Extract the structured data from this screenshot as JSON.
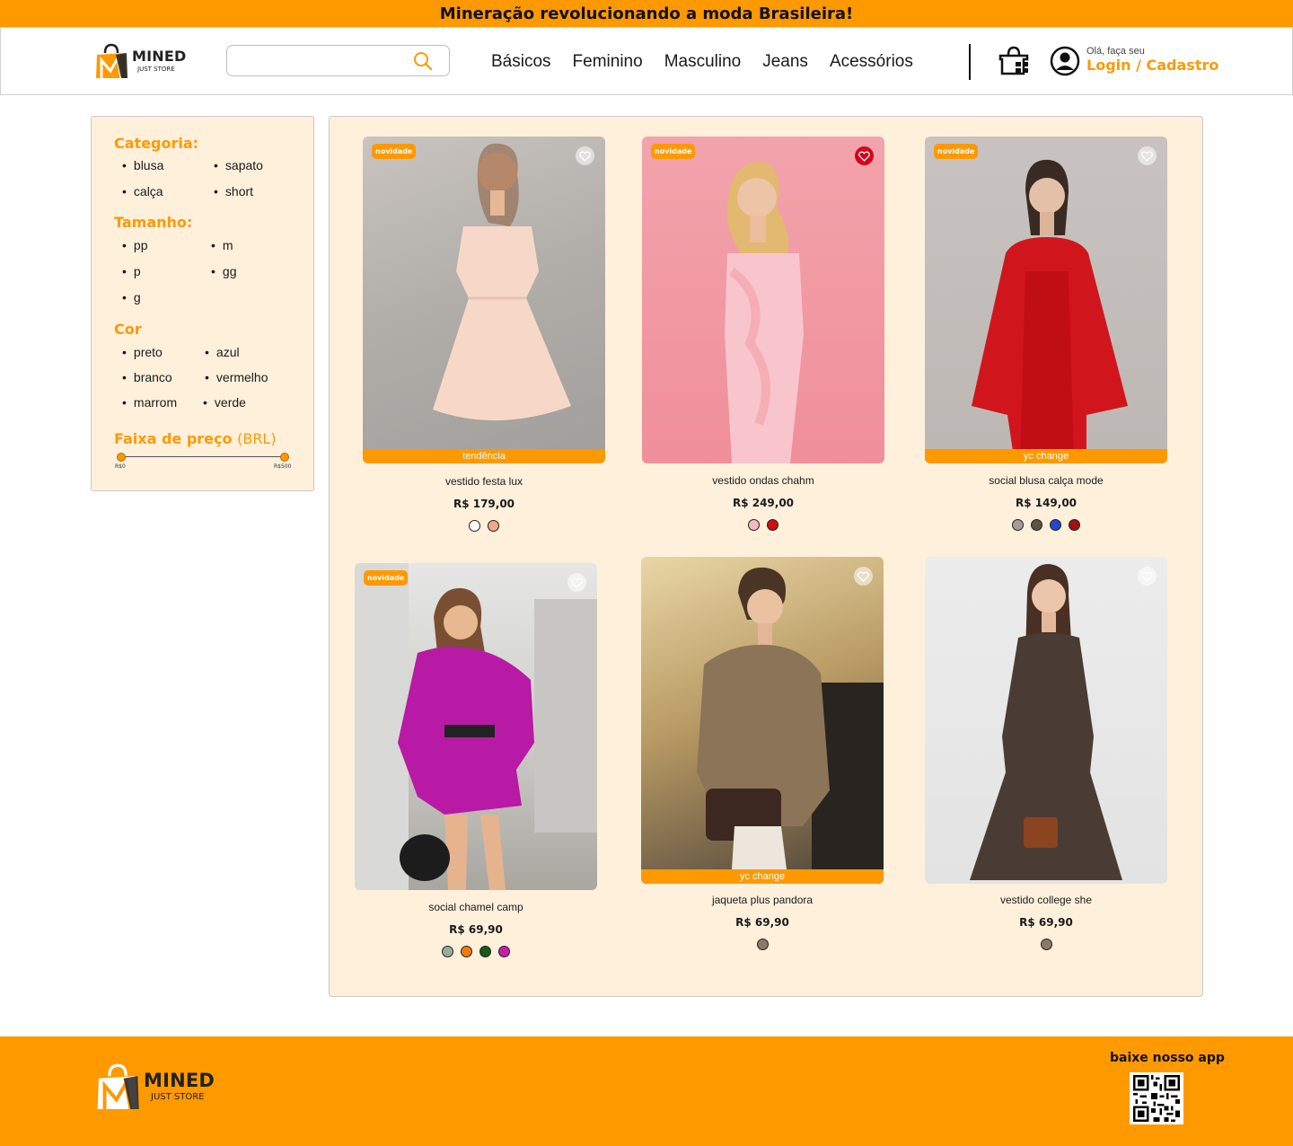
{
  "banner": {
    "text": "Mineração revolucionando a moda Brasileira!"
  },
  "brand": {
    "name": "MINED",
    "tagline": "JUST STORE"
  },
  "search": {
    "placeholder": ""
  },
  "nav": {
    "items": [
      "Básicos",
      "Feminino",
      "Masculino",
      "Jeans",
      "Acessórios"
    ]
  },
  "account": {
    "greeting": "Olá, faça seu",
    "link": "Login / Cadastro"
  },
  "filters": {
    "categoria": {
      "title": "Categoria:",
      "items": [
        "blusa",
        "sapato",
        "calça",
        "short"
      ]
    },
    "tamanho": {
      "title": "Tamanho:",
      "items": [
        "pp",
        "m",
        "p",
        "gg",
        "g"
      ]
    },
    "cor": {
      "title": "Cor",
      "items": [
        "preto",
        "azul",
        "branco",
        "vermelho",
        "marrom",
        "verde"
      ]
    },
    "preco": {
      "title": "Faixa de preço",
      "unit": "(BRL)",
      "min_label": "R$0",
      "max_label": "R$500",
      "range": [
        0,
        500
      ]
    }
  },
  "products": [
    {
      "name": "vestido festa lux",
      "price": "R$ 179,00",
      "badge": "novidade",
      "strip": "tendência",
      "favorite": false,
      "colors": [
        "#ffffff",
        "#f0a98a"
      ]
    },
    {
      "name": "vestido ondas chahm",
      "price": "R$ 249,00",
      "badge": "novidade",
      "strip": "",
      "favorite": true,
      "colors": [
        "#f7b8c0",
        "#cc1010"
      ]
    },
    {
      "name": "social blusa calça mode",
      "price": "R$ 149,00",
      "badge": "novidade",
      "strip": "yc change",
      "favorite": false,
      "colors": [
        "#a89a9a",
        "#5e5245",
        "#2546c8",
        "#a01016"
      ]
    },
    {
      "name": "social chamel camp",
      "price": "R$ 69,90",
      "badge": "novidade",
      "strip": "",
      "favorite": false,
      "colors": [
        "#9aab98",
        "#ee7a12",
        "#1a5a14",
        "#cc1ca6"
      ]
    },
    {
      "name": "jaqueta plus pandora",
      "price": "R$ 69,90",
      "badge": "",
      "strip": "yc change",
      "favorite": false,
      "colors": [
        "#8c7866"
      ]
    },
    {
      "name": "vestido college she",
      "price": "R$ 69,90",
      "badge": "",
      "strip": "",
      "favorite": false,
      "colors": [
        "#8c7866"
      ]
    }
  ],
  "footer": {
    "app_label": "baixe nosso app"
  },
  "colors": {
    "accent": "#ff9900",
    "panel": "#fff0dc"
  }
}
